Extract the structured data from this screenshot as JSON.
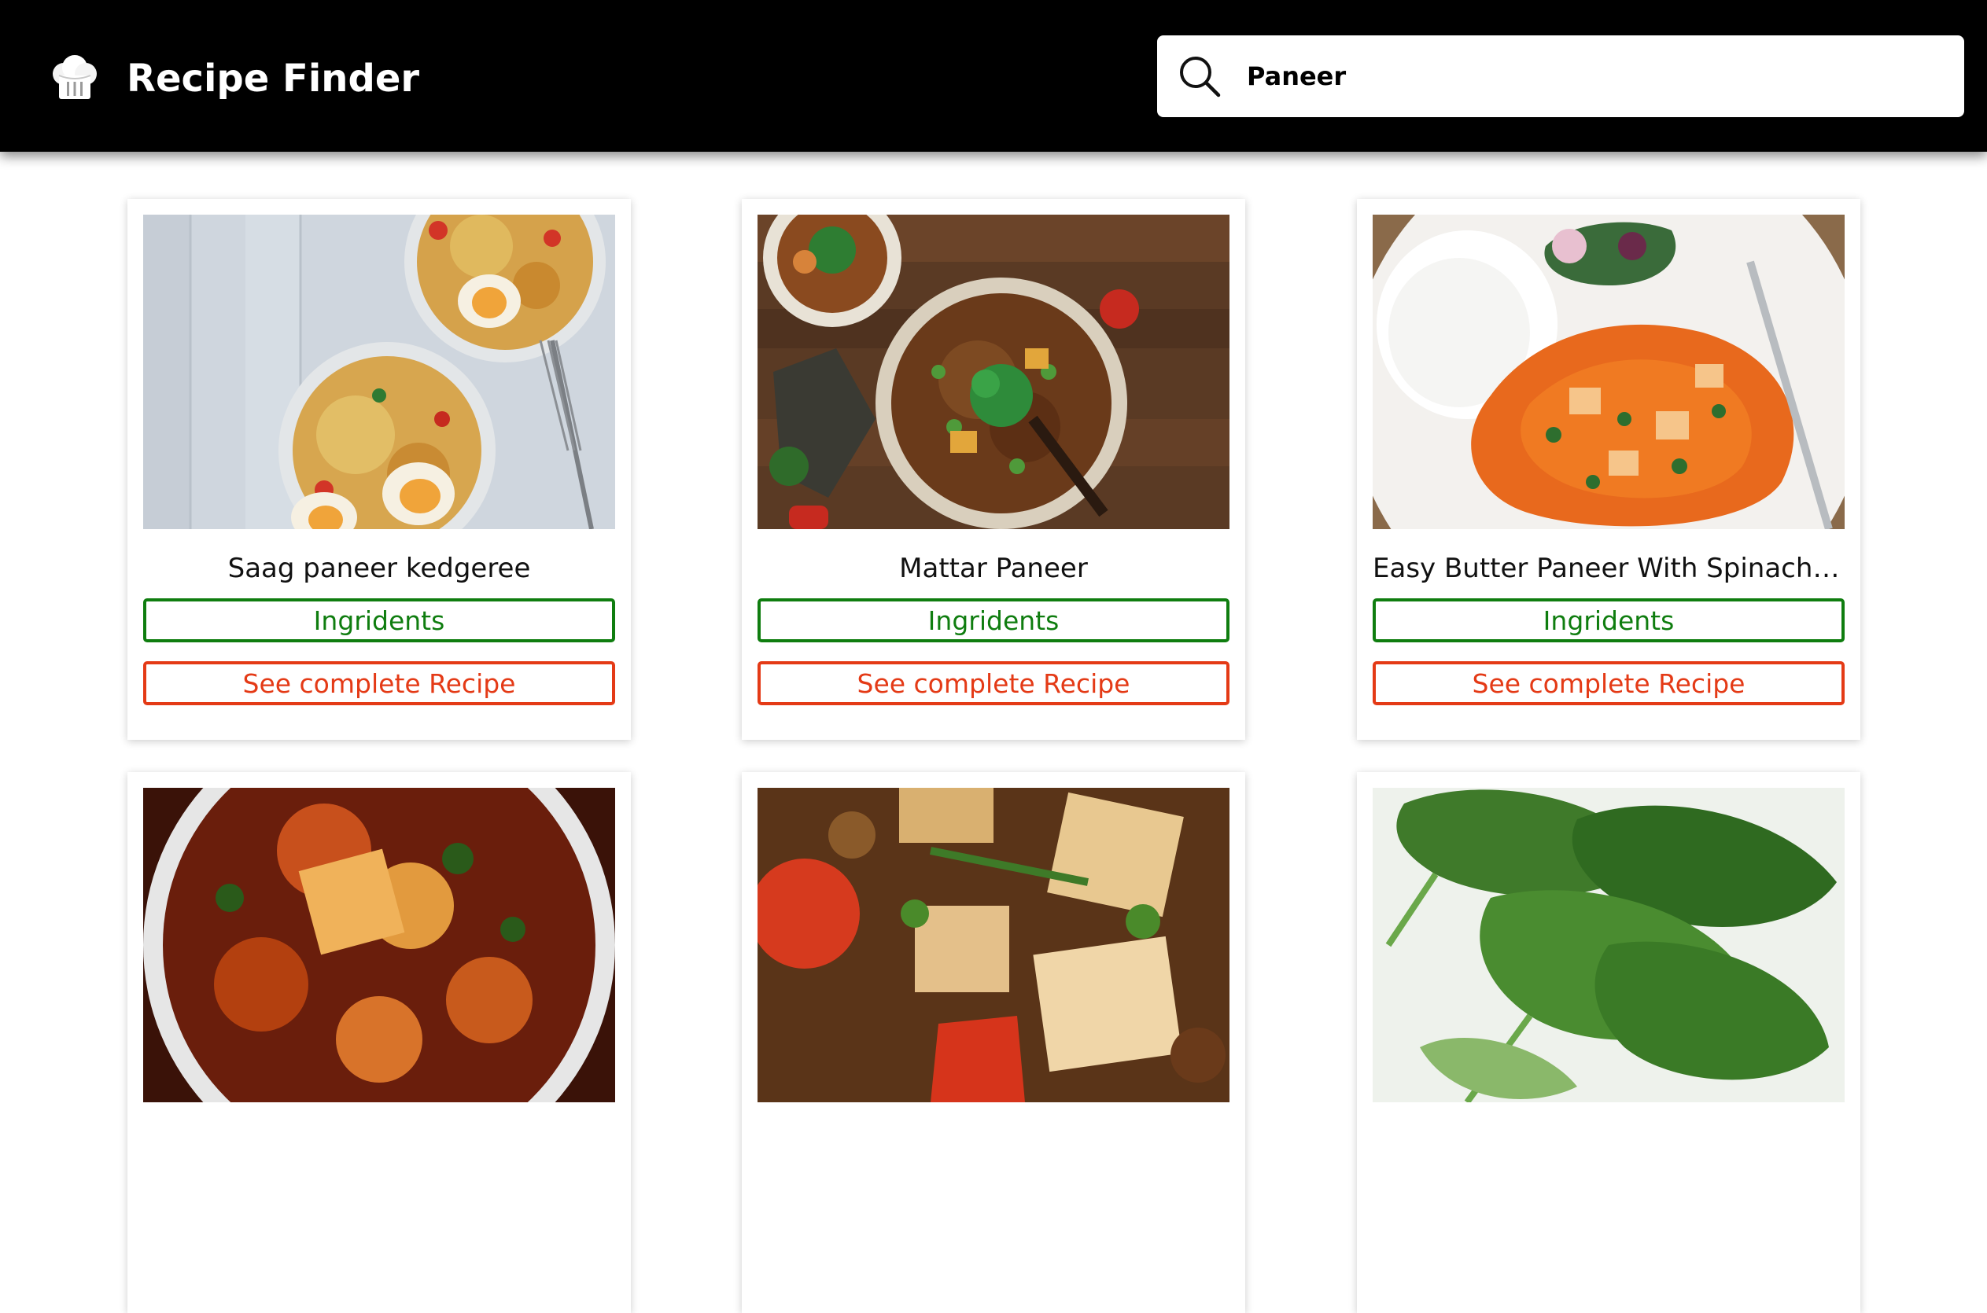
{
  "header": {
    "title": "Recipe Finder",
    "logo_icon": "chef-hat-icon"
  },
  "search": {
    "value": "Paneer",
    "icon": "search-icon"
  },
  "colors": {
    "navbar": "#000000",
    "ingredients_accent": "#0f7d0f",
    "recipe_accent": "#e43a16"
  },
  "recipes": [
    {
      "title": "Saag paneer kedgeree",
      "ingredients_label": "Ingridents",
      "recipe_label": "See complete Recipe"
    },
    {
      "title": "Mattar Paneer",
      "ingredients_label": "Ingridents",
      "recipe_label": "See complete Recipe"
    },
    {
      "title": "Easy Butter Paneer With Spinach R...",
      "ingredients_label": "Ingridents",
      "recipe_label": "See complete Recipe"
    },
    {},
    {},
    {}
  ]
}
